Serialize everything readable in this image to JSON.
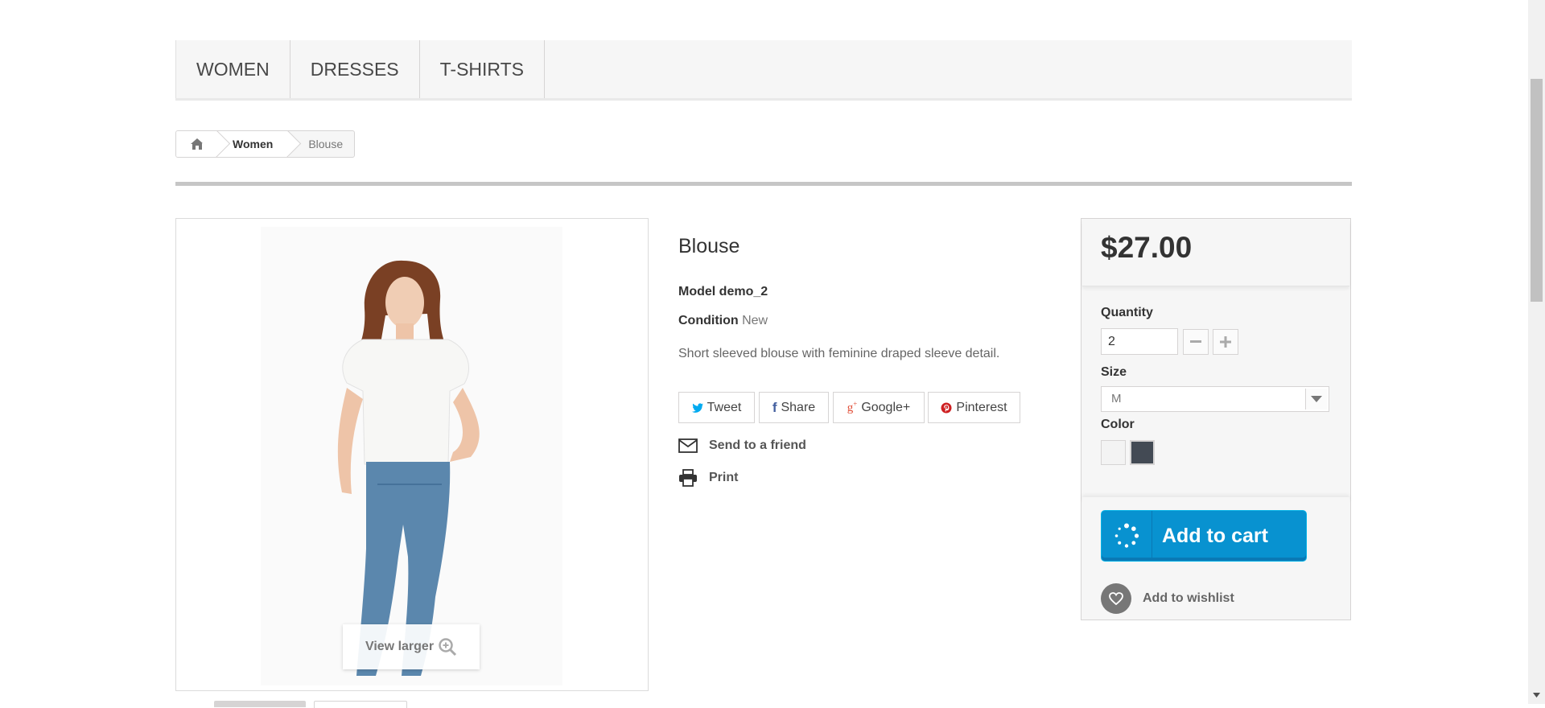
{
  "menu": {
    "items": [
      "WOMEN",
      "DRESSES",
      "T-SHIRTS"
    ]
  },
  "breadcrumb": {
    "home_icon": "home-icon",
    "items": [
      "Women",
      "Blouse"
    ]
  },
  "image": {
    "view_larger_label": "View larger",
    "zoom_icon": "zoom-in-icon"
  },
  "product": {
    "title": "Blouse",
    "model_label": "Model",
    "model_value": "demo_2",
    "condition_label": "Condition",
    "condition_value": "New",
    "description": "Short sleeved blouse with feminine draped sleeve detail."
  },
  "share": {
    "tweet": "Tweet",
    "share": "Share",
    "google": "Google+",
    "pinterest": "Pinterest"
  },
  "links": {
    "send_friend": "Send to a friend",
    "print": "Print"
  },
  "buy": {
    "price": "$27.00",
    "quantity_label": "Quantity",
    "quantity_value": "2",
    "size_label": "Size",
    "size_value": "M",
    "color_label": "Color",
    "colors": [
      "#f3f3f3",
      "#434a54"
    ],
    "add_to_cart": "Add to cart",
    "add_to_wishlist": "Add to wishlist",
    "accent_color": "#0892d0"
  }
}
